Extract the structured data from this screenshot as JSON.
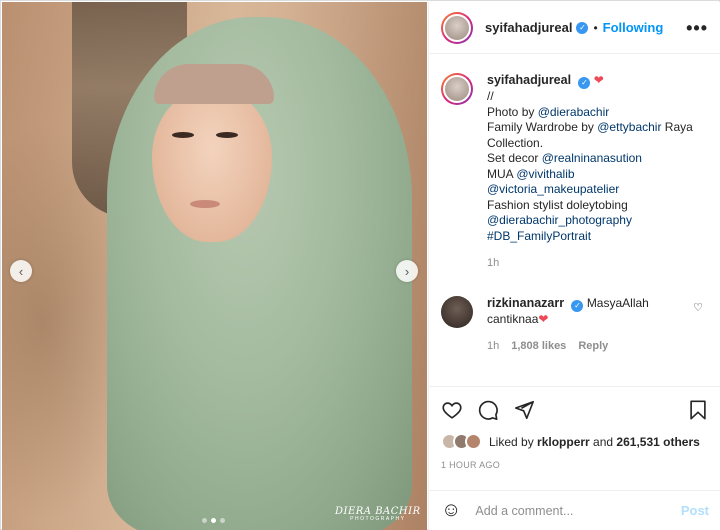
{
  "post": {
    "carousel": {
      "prev_icon": "‹",
      "next_icon": "›",
      "slide_count": 3,
      "active_slide": 2
    },
    "watermark": {
      "line1": "DIERA BACHIR",
      "line2": "PHOTOGRAPHY"
    }
  },
  "header": {
    "username": "syifahadjureal",
    "separator": "•",
    "follow_label": "Following",
    "more_icon": "•••"
  },
  "caption": {
    "username": "syifahadjureal",
    "heart": "❤",
    "lines": [
      "//",
      "Photo by ",
      "@dierabachir",
      "Family Wardrobe by ",
      "@ettybachir",
      " Raya Collection.",
      "Set decor ",
      "@realninanasution",
      "MUA ",
      "@vivithalib",
      "@victoria_makeupatelier",
      "Fashion stylist doleytobing",
      "@dierabachir_photography",
      "#DB_FamilyPortrait"
    ],
    "time": "1h"
  },
  "comment": {
    "username": "rizkinanazarr",
    "text": "MasyaAllah cantiknaa",
    "heart": "❤",
    "time": "1h",
    "likes": "1,808 likes",
    "reply": "Reply",
    "like_icon": "♡"
  },
  "actions": {
    "liked_by_prefix": "Liked by ",
    "liked_by_user": "rklopperr",
    "liked_by_mid": " and ",
    "liked_by_count": "261,531 others",
    "time_ago": "1 HOUR AGO"
  },
  "add_comment": {
    "placeholder": "Add a comment...",
    "post_label": "Post",
    "emoji_icon": "☺"
  },
  "colors": {
    "accent": "#0095f6",
    "verified": "#3897f0",
    "heart": "#ed4956",
    "post_disabled": "#b2dffc"
  }
}
